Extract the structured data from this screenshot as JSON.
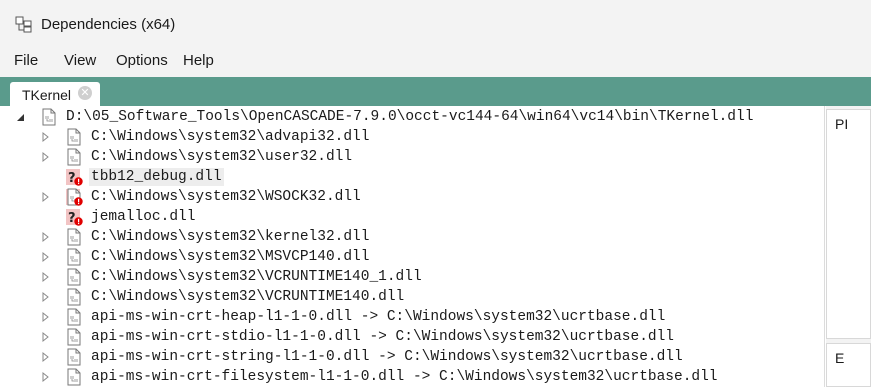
{
  "window": {
    "title": "Dependencies (x64)",
    "icon": "dependencies-app-icon"
  },
  "menu": [
    "File",
    "View",
    "Options",
    "Help"
  ],
  "tabs": [
    {
      "label": "TKernel",
      "close_icon": "close-icon"
    }
  ],
  "tree": {
    "root": {
      "text": "D:\\05_Software_Tools\\OpenCASCADE-7.9.0\\occt-vc144-64\\win64\\vc14\\bin\\TKernel.dll",
      "expander": "expanded",
      "icon": "module-icon"
    },
    "children": [
      {
        "text": "C:\\Windows\\system32\\advapi32.dll",
        "expander": "collapsed",
        "icon": "module-icon"
      },
      {
        "text": "C:\\Windows\\system32\\user32.dll",
        "expander": "collapsed",
        "icon": "module-icon"
      },
      {
        "text": "tbb12_debug.dll",
        "expander": "none",
        "icon": "missing-module-icon",
        "selected": true
      },
      {
        "text": "C:\\Windows\\system32\\WSOCK32.dll",
        "expander": "collapsed",
        "icon": "module-error-icon"
      },
      {
        "text": "jemalloc.dll",
        "expander": "none",
        "icon": "missing-module-icon"
      },
      {
        "text": "C:\\Windows\\system32\\kernel32.dll",
        "expander": "collapsed",
        "icon": "module-icon"
      },
      {
        "text": "C:\\Windows\\system32\\MSVCP140.dll",
        "expander": "collapsed",
        "icon": "module-icon"
      },
      {
        "text": "C:\\Windows\\system32\\VCRUNTIME140_1.dll",
        "expander": "collapsed",
        "icon": "module-icon"
      },
      {
        "text": "C:\\Windows\\system32\\VCRUNTIME140.dll",
        "expander": "collapsed",
        "icon": "module-icon"
      },
      {
        "text": "api-ms-win-crt-heap-l1-1-0.dll -> C:\\Windows\\system32\\ucrtbase.dll",
        "expander": "collapsed",
        "icon": "module-icon"
      },
      {
        "text": "api-ms-win-crt-stdio-l1-1-0.dll -> C:\\Windows\\system32\\ucrtbase.dll",
        "expander": "collapsed",
        "icon": "module-icon"
      },
      {
        "text": "api-ms-win-crt-string-l1-1-0.dll -> C:\\Windows\\system32\\ucrtbase.dll",
        "expander": "collapsed",
        "icon": "module-icon"
      },
      {
        "text": "api-ms-win-crt-filesystem-l1-1-0.dll -> C:\\Windows\\system32\\ucrtbase.dll",
        "expander": "collapsed",
        "icon": "module-icon"
      }
    ]
  },
  "side_panels": {
    "top_label": "PI",
    "bottom_label": "E"
  },
  "colors": {
    "tab_strip": "#5a9b8c",
    "missing_icon_bg": "#f2c4c4",
    "error_badge": "#e00000"
  }
}
